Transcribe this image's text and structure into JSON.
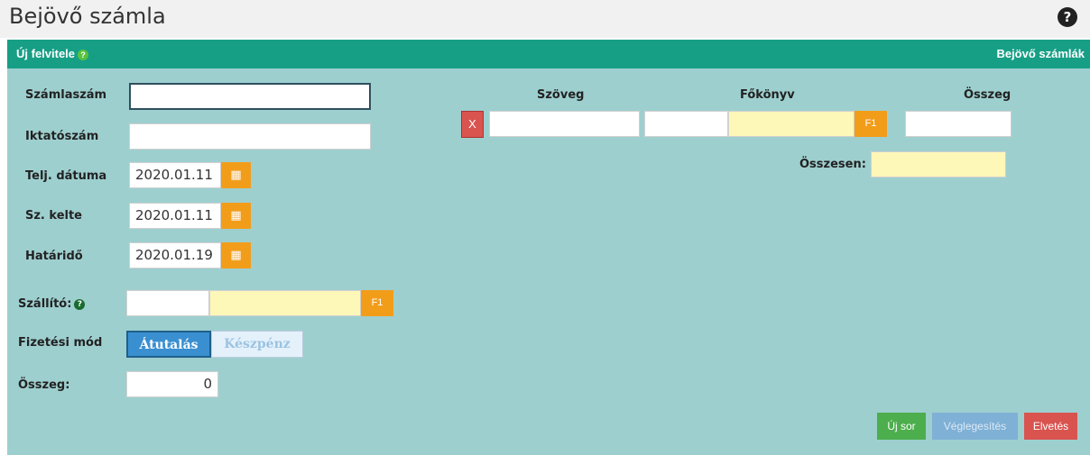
{
  "window": {
    "title": "Bejövő számla",
    "help_icon": "?"
  },
  "header": {
    "left_label": "Új felvitele",
    "right_label": "Bejövő számlák"
  },
  "form": {
    "szamlaszam_label": "Számlaszám",
    "szamlaszam_value": "",
    "iktatoszam_label": "Iktatószám",
    "iktatoszam_value": "",
    "telj_datuma_label": "Telj. dátuma",
    "telj_datuma_value": "2020.01.11",
    "sz_kelte_label": "Sz. kelte",
    "sz_kelte_value": "2020.01.11",
    "hatarido_label": "Határidő",
    "hatarido_value": "2020.01.19",
    "szallito_label": "Szállító:",
    "szallito_code": "",
    "szallito_name": "",
    "szallito_f1": "F1",
    "fizetesi_mod_label": "Fizetési mód",
    "fizetesi_options": [
      "Átutalás",
      "Készpénz"
    ],
    "fizetesi_selected": "Átutalás",
    "osszeg_label": "Összeg:",
    "osszeg_value": "0"
  },
  "lines": {
    "col_szoveg": "Szöveg",
    "col_fokonyv": "Főkönyv",
    "col_osszeg": "Összeg",
    "delete_label": "X",
    "row_szoveg": "",
    "row_fokonyv_code": "",
    "row_fokonyv_name": "",
    "row_f1": "F1",
    "row_osszeg": "",
    "osszesen_label": "Összesen:",
    "osszesen_value": ""
  },
  "actions": {
    "new_row": "Új sor",
    "finalize": "Véglegesítés",
    "discard": "Elvetés"
  },
  "colors": {
    "panel_bg": "#9ecfcf",
    "header_bg": "#179f86",
    "accent_orange": "#f29d1a",
    "highlight_yellow": "#fdf7b8"
  }
}
